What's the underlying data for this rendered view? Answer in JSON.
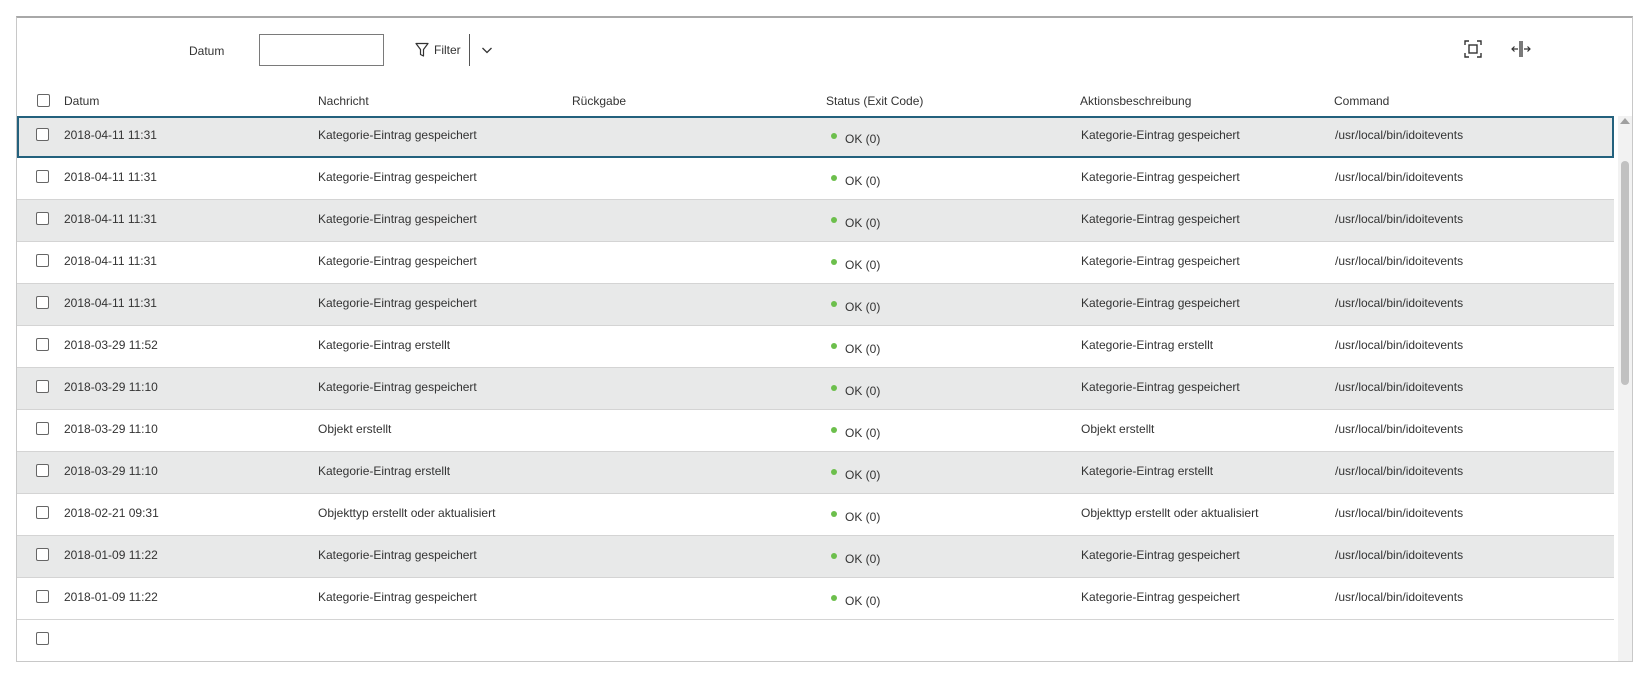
{
  "toolbar": {
    "datum_label": "Datum",
    "datum_value": "",
    "filter_label": "Filter",
    "icons": [
      "filter-icon",
      "chevron-down-icon",
      "fullscreen-icon",
      "resize-columns-icon"
    ]
  },
  "table": {
    "headers": {
      "datum": "Datum",
      "nachricht": "Nachricht",
      "rueckgabe": "Rückgabe",
      "status": "Status (Exit Code)",
      "aktionsbeschreibung": "Aktionsbeschreibung",
      "command": "Command"
    },
    "rows": [
      {
        "datum": "2018-04-11 11:31",
        "nachricht": "Kategorie-Eintrag gespeichert",
        "rueckgabe": "",
        "status": "OK (0)",
        "aktion": "Kategorie-Eintrag gespeichert",
        "command": "/usr/local/bin/idoitevents"
      },
      {
        "datum": "2018-04-11 11:31",
        "nachricht": "Kategorie-Eintrag gespeichert",
        "rueckgabe": "",
        "status": "OK (0)",
        "aktion": "Kategorie-Eintrag gespeichert",
        "command": "/usr/local/bin/idoitevents"
      },
      {
        "datum": "2018-04-11 11:31",
        "nachricht": "Kategorie-Eintrag gespeichert",
        "rueckgabe": "",
        "status": "OK (0)",
        "aktion": "Kategorie-Eintrag gespeichert",
        "command": "/usr/local/bin/idoitevents"
      },
      {
        "datum": "2018-04-11 11:31",
        "nachricht": "Kategorie-Eintrag gespeichert",
        "rueckgabe": "",
        "status": "OK (0)",
        "aktion": "Kategorie-Eintrag gespeichert",
        "command": "/usr/local/bin/idoitevents"
      },
      {
        "datum": "2018-04-11 11:31",
        "nachricht": "Kategorie-Eintrag gespeichert",
        "rueckgabe": "",
        "status": "OK (0)",
        "aktion": "Kategorie-Eintrag gespeichert",
        "command": "/usr/local/bin/idoitevents"
      },
      {
        "datum": "2018-03-29 11:52",
        "nachricht": "Kategorie-Eintrag erstellt",
        "rueckgabe": "",
        "status": "OK (0)",
        "aktion": "Kategorie-Eintrag erstellt",
        "command": "/usr/local/bin/idoitevents"
      },
      {
        "datum": "2018-03-29 11:10",
        "nachricht": "Kategorie-Eintrag gespeichert",
        "rueckgabe": "",
        "status": "OK (0)",
        "aktion": "Kategorie-Eintrag gespeichert",
        "command": "/usr/local/bin/idoitevents"
      },
      {
        "datum": "2018-03-29 11:10",
        "nachricht": "Objekt erstellt",
        "rueckgabe": "",
        "status": "OK (0)",
        "aktion": "Objekt erstellt",
        "command": "/usr/local/bin/idoitevents"
      },
      {
        "datum": "2018-03-29 11:10",
        "nachricht": "Kategorie-Eintrag erstellt",
        "rueckgabe": "",
        "status": "OK (0)",
        "aktion": "Kategorie-Eintrag erstellt",
        "command": "/usr/local/bin/idoitevents"
      },
      {
        "datum": "2018-02-21 09:31",
        "nachricht": "Objekttyp erstellt oder aktualisiert",
        "rueckgabe": "",
        "status": "OK (0)",
        "aktion": "Objekttyp erstellt oder aktualisiert",
        "command": "/usr/local/bin/idoitevents"
      },
      {
        "datum": "2018-01-09 11:22",
        "nachricht": "Kategorie-Eintrag gespeichert",
        "rueckgabe": "",
        "status": "OK (0)",
        "aktion": "Kategorie-Eintrag gespeichert",
        "command": "/usr/local/bin/idoitevents"
      },
      {
        "datum": "2018-01-09 11:22",
        "nachricht": "Kategorie-Eintrag gespeichert",
        "rueckgabe": "",
        "status": "OK (0)",
        "aktion": "Kategorie-Eintrag gespeichert",
        "command": "/usr/local/bin/idoitevents"
      }
    ],
    "selected_row": 0
  },
  "colors": {
    "row_alt": "#e8e9e9",
    "selected_border": "#23617d",
    "status_ok": "#6cbf4c"
  }
}
